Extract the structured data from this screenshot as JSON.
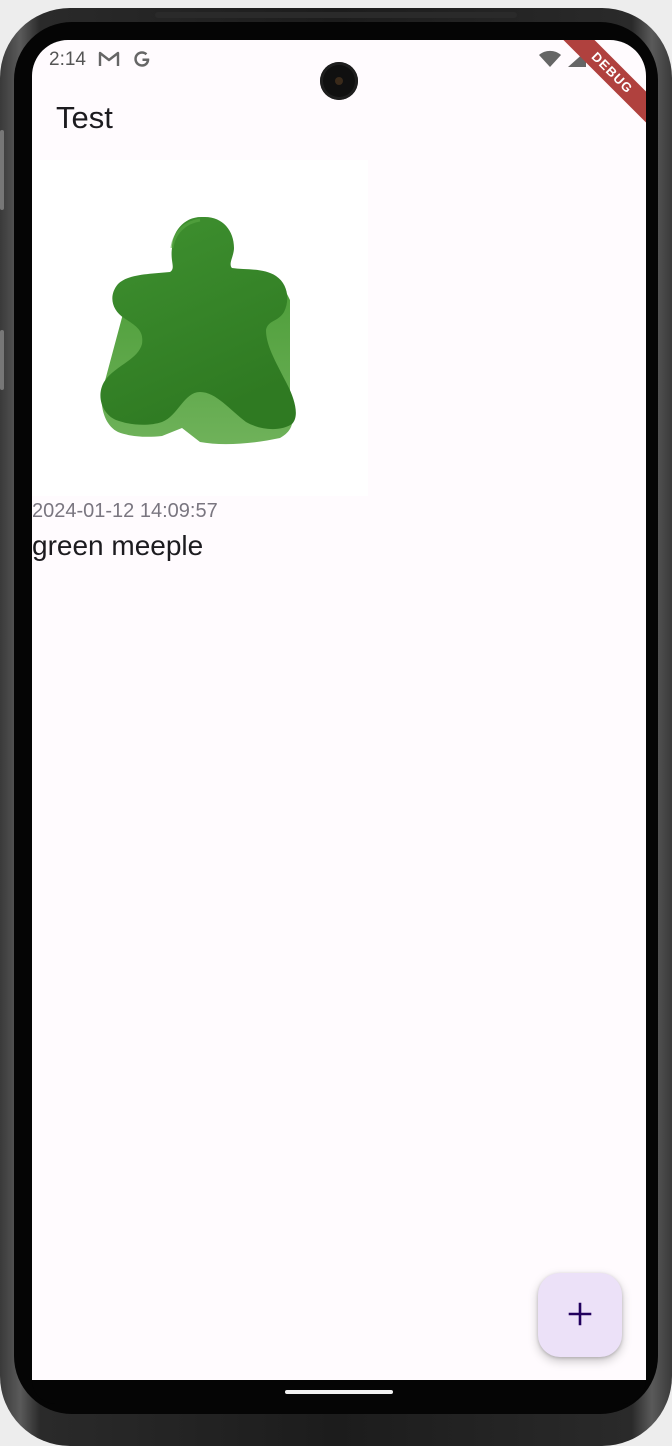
{
  "status_bar": {
    "time": "2:14",
    "icons": [
      "gmail-icon",
      "google-icon",
      "wifi-icon",
      "cellular-icon",
      "battery-icon"
    ],
    "debug_label": "DEBUG"
  },
  "app_bar": {
    "title": "Test"
  },
  "items": [
    {
      "image": "green-meeple-image",
      "date": "2024-01-12 14:09:57",
      "name": "green meeple"
    }
  ],
  "fab": {
    "icon": "plus-icon"
  },
  "colors": {
    "background": "#fffbfe",
    "fab_background": "#ece1f8",
    "fab_icon": "#21005d",
    "meeple_green": "#3a8a2a",
    "debug_banner": "#b0413e"
  }
}
